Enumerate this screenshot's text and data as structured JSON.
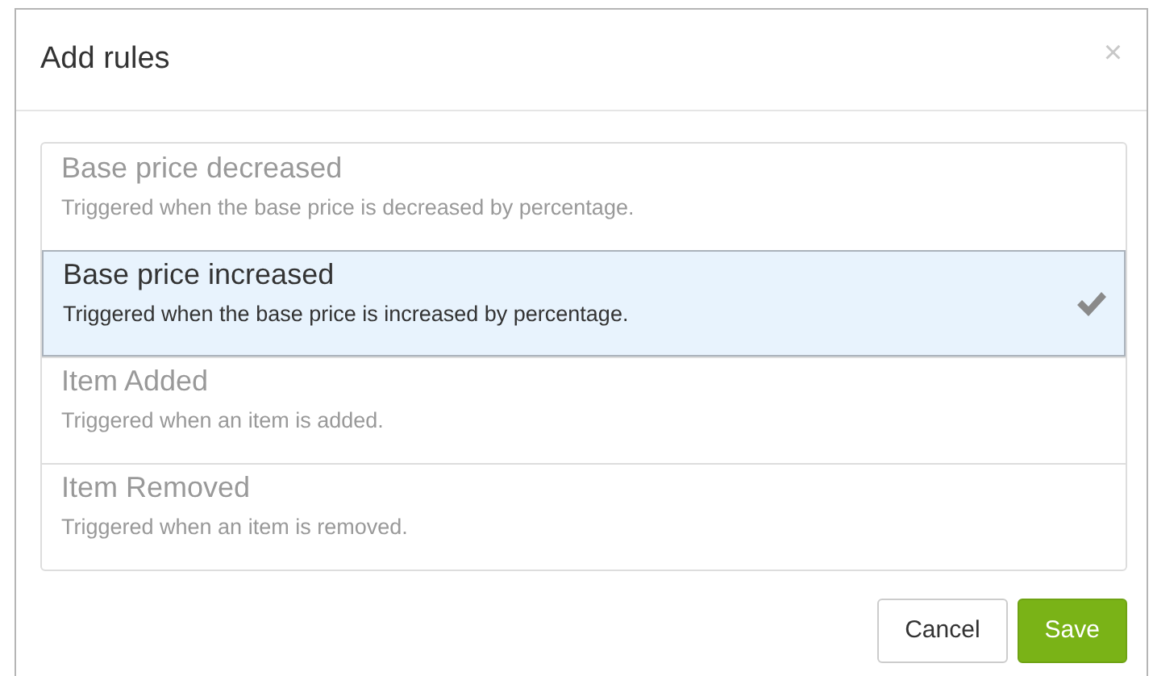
{
  "dialog": {
    "title": "Add rules",
    "close": "×"
  },
  "rules": [
    {
      "name": "Base price decreased",
      "description": "Triggered when the base price is decreased by percentage.",
      "selected": false
    },
    {
      "name": "Base price increased",
      "description": "Triggered when the base price is increased by percentage.",
      "selected": true
    },
    {
      "name": "Item Added",
      "description": "Triggered when an item is added.",
      "selected": false
    },
    {
      "name": "Item Removed",
      "description": "Triggered when an item is removed.",
      "selected": false
    }
  ],
  "buttons": [
    {
      "label": "Cancel",
      "kind": "secondary"
    },
    {
      "label": "Save",
      "kind": "primary"
    }
  ]
}
